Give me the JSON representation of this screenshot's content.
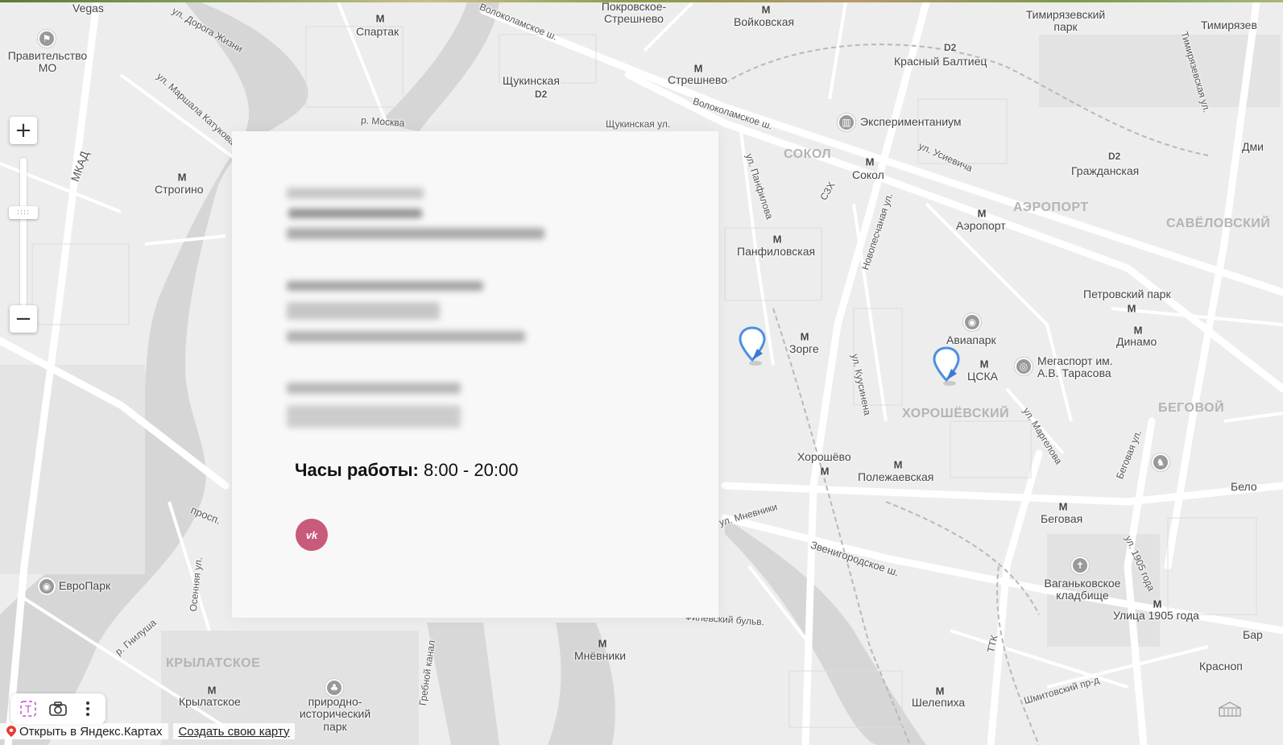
{
  "map": {
    "districts": [
      "СОКОЛ",
      "АЭРОПОРТ",
      "САВЁЛОВСКИЙ",
      "ХОРОШЁВСКИЙ",
      "БЕГОВОЙ",
      "КРЫЛАТСКОЕ"
    ],
    "metro_stations": [
      "Спартак",
      "Войковская",
      "Стрешнево",
      "Щукинская",
      "Строгино",
      "Сокол",
      "Аэропорт",
      "Панфиловская",
      "Зорге",
      "ЦСКА",
      "Хорошёво",
      "Полежаевская",
      "Беговая",
      "Динамо",
      "Петровский парк",
      "Улица 1905 года",
      "Мнёвники",
      "Крылатское",
      "Шелепиха"
    ],
    "rail_stations": [
      "Красный Балтиец",
      "Гражданская"
    ],
    "places": [
      "Vegas",
      "Покровское-Стрешнево",
      "Тимирязевский парк",
      "Тимирязев",
      "Правительство МО",
      "Экспериментаниум",
      "Авиапарк",
      "Мегаспорт им. А.В. Тарасова",
      "Ваганьковское кладбище",
      "ЕвроПарк",
      "природно-исторический парк",
      "Красноп",
      "Бар",
      "Бело",
      "Дми"
    ],
    "streets": [
      "Волоколамское ш.",
      "Волоколамское ш.",
      "Щукинская ул.",
      "ул. Маршала Катукова",
      "МКАД",
      "р. Москва",
      "ул. Усиевича",
      "Новопесчаная ул.",
      "ул. Панфилова",
      "СЗХ",
      "ул. Куусинена",
      "ул. Маргелова",
      "Беговая ул.",
      "Звенигородское ш.",
      "Филевский бульв.",
      "ул. 1905 года",
      "Шмитовский пр-д",
      "ТТК",
      "Гребной канал",
      "Осенняя ул.",
      "р. Гнилуша",
      "просп.",
      "ул. Мневники",
      "Тимирязевская ул.",
      "ул. Дорога Жизни"
    ],
    "badges": [
      "D2"
    ]
  },
  "card": {
    "hours_label": "Часы работы:",
    "hours_value": "8:00 - 20:00",
    "social": "vk-icon"
  },
  "controls": {
    "zoom_in": "+",
    "zoom_out": "−",
    "open_link": "Открыть в Яндекс.Картах",
    "create_link": "Создать свою карту"
  },
  "colors": {
    "vk": "#c85a7c",
    "pin": "#4a90e2",
    "card": "#f8f8f8",
    "map_bg": "#ededed"
  }
}
